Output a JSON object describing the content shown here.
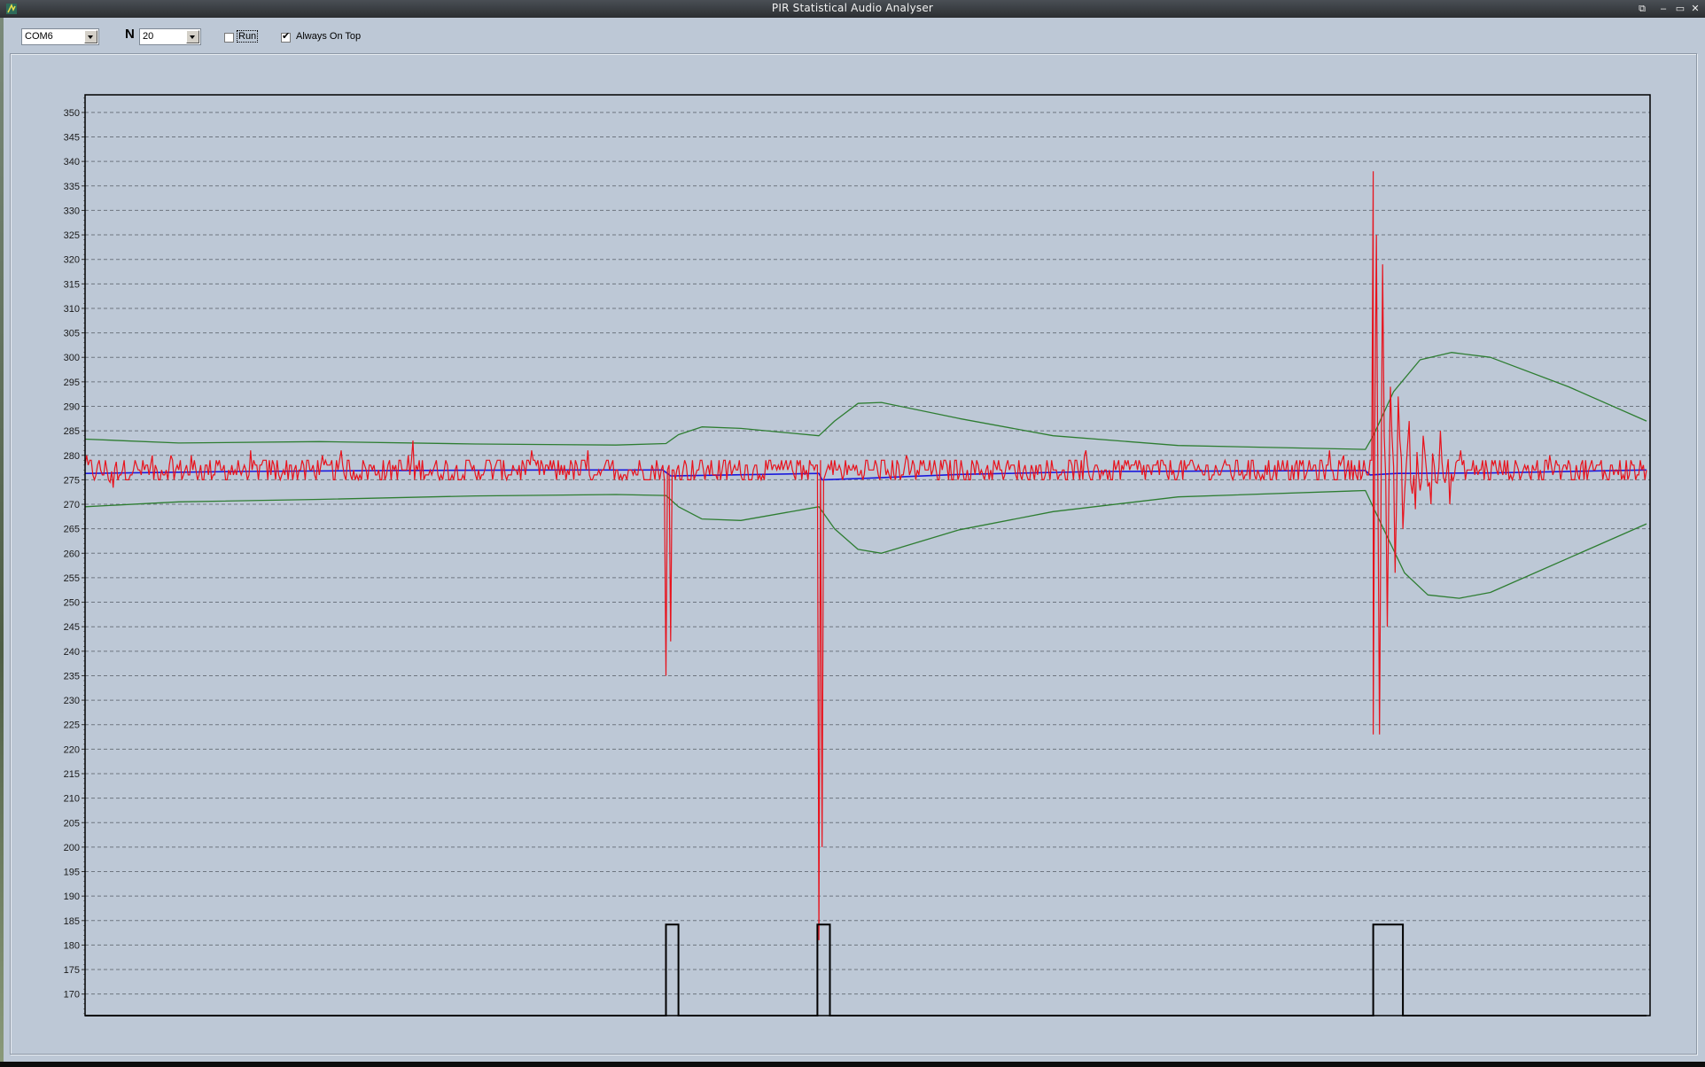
{
  "window": {
    "title": "PIR Statistical Audio Analyser",
    "icons": [
      "app-icon",
      "restore-icon",
      "minimize-icon",
      "maximize-icon",
      "close-icon"
    ]
  },
  "toolbar": {
    "port_select": {
      "value": "COM6"
    },
    "n_label": "N",
    "n_select": {
      "value": "20"
    },
    "run_checkbox": {
      "label": "Run",
      "checked": false
    },
    "always_on_top_checkbox": {
      "label": "Always On Top",
      "checked": true
    }
  },
  "colors": {
    "signal": "#e8121c",
    "mean": "#1a1adc",
    "bands": "#2e7d32",
    "trigger": "#000000",
    "grid": "#6e7680",
    "plot_bg": "#bdc8d6"
  },
  "chart_data": {
    "type": "line",
    "title": "",
    "xlabel": "",
    "ylabel": "",
    "ylim": [
      165.6,
      353.6
    ],
    "x_range": [
      0,
      1000
    ],
    "yticks": [
      170,
      175,
      180,
      185,
      190,
      195,
      200,
      205,
      210,
      215,
      220,
      225,
      230,
      235,
      240,
      245,
      250,
      255,
      260,
      265,
      270,
      275,
      280,
      285,
      290,
      295,
      300,
      305,
      310,
      315,
      320,
      325,
      330,
      335,
      340,
      345,
      350
    ],
    "grid": true,
    "legend": "none",
    "series": [
      {
        "name": "upper-band",
        "color": "#2e7d32",
        "points": [
          [
            0,
            283.3
          ],
          [
            60,
            282.5
          ],
          [
            150,
            282.8
          ],
          [
            250,
            282.3
          ],
          [
            340,
            282.1
          ],
          [
            372,
            282.4
          ],
          [
            380,
            284.2
          ],
          [
            395,
            285.8
          ],
          [
            420,
            285.5
          ],
          [
            470,
            284.0
          ],
          [
            470,
            284.0
          ],
          [
            480,
            287.0
          ],
          [
            495,
            290.6
          ],
          [
            510,
            290.8
          ],
          [
            560,
            287.5
          ],
          [
            620,
            284.0
          ],
          [
            700,
            282.0
          ],
          [
            820,
            281.2
          ],
          [
            825,
            284.0
          ],
          [
            838,
            293.0
          ],
          [
            855,
            299.5
          ],
          [
            875,
            301.0
          ],
          [
            900,
            300.0
          ],
          [
            950,
            294.0
          ],
          [
            1000,
            287.0
          ]
        ]
      },
      {
        "name": "lower-band",
        "color": "#2e7d32",
        "points": [
          [
            0,
            269.5
          ],
          [
            60,
            270.5
          ],
          [
            150,
            271.0
          ],
          [
            250,
            271.7
          ],
          [
            340,
            272.0
          ],
          [
            372,
            271.8
          ],
          [
            380,
            269.5
          ],
          [
            395,
            267.0
          ],
          [
            420,
            266.7
          ],
          [
            470,
            269.5
          ],
          [
            480,
            265.0
          ],
          [
            495,
            260.8
          ],
          [
            510,
            260.0
          ],
          [
            560,
            264.8
          ],
          [
            620,
            268.5
          ],
          [
            700,
            271.5
          ],
          [
            820,
            272.8
          ],
          [
            830,
            266.0
          ],
          [
            845,
            256.0
          ],
          [
            860,
            251.5
          ],
          [
            880,
            250.8
          ],
          [
            900,
            252.0
          ],
          [
            950,
            259.0
          ],
          [
            1000,
            266.0
          ]
        ]
      },
      {
        "name": "mean",
        "color": "#1a1adc",
        "points": [
          [
            0,
            276.3
          ],
          [
            100,
            276.7
          ],
          [
            200,
            276.9
          ],
          [
            300,
            277.0
          ],
          [
            370,
            277.0
          ],
          [
            375,
            275.8
          ],
          [
            470,
            276.3
          ],
          [
            472,
            275.0
          ],
          [
            500,
            275.3
          ],
          [
            560,
            276.1
          ],
          [
            650,
            276.7
          ],
          [
            820,
            276.9
          ],
          [
            823,
            276.0
          ],
          [
            840,
            276.3
          ],
          [
            900,
            276.4
          ],
          [
            1000,
            277.0
          ]
        ]
      },
      {
        "name": "signal",
        "color": "#e8121c",
        "baseline": 277,
        "noise_amplitude": 2.5,
        "spikes": [
          {
            "x": 372,
            "min": 235
          },
          {
            "x": 375,
            "min": 242
          },
          {
            "x": 470,
            "min": 181
          },
          {
            "x": 472,
            "min": 200
          },
          {
            "x": 825,
            "min": 223,
            "max": 338
          },
          {
            "x": 827,
            "max": 325
          },
          {
            "x": 829,
            "min": 223
          },
          {
            "x": 831,
            "max": 319
          },
          {
            "x": 834,
            "min": 245
          },
          {
            "x": 836,
            "max": 294
          },
          {
            "x": 839,
            "min": 256
          },
          {
            "x": 841,
            "max": 292
          },
          {
            "x": 844,
            "min": 265
          },
          {
            "x": 848,
            "max": 287
          },
          {
            "x": 852,
            "min": 269
          },
          {
            "x": 857,
            "max": 284
          },
          {
            "x": 862,
            "min": 270
          },
          {
            "x": 868,
            "max": 285
          },
          {
            "x": 874,
            "min": 270
          }
        ]
      },
      {
        "name": "trigger",
        "color": "#000000",
        "low": 165.6,
        "high": 184.2,
        "pulses": [
          [
            372,
            380
          ],
          [
            469,
            477
          ],
          [
            825,
            844
          ]
        ]
      }
    ]
  }
}
